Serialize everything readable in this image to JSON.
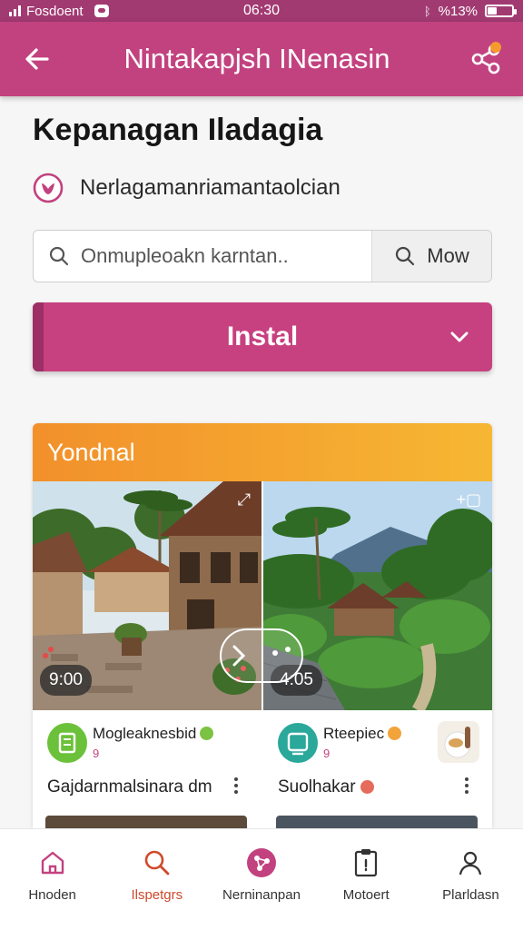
{
  "status_bar": {
    "carrier": "Fosdoent",
    "time": "06:30",
    "battery": "%13%"
  },
  "app_bar": {
    "title": "Nintakapjsh INenasin"
  },
  "page": {
    "heading": "Kepanagan Iladagia",
    "subtitle": "Nerlagamanriamantaolcian"
  },
  "search": {
    "placeholder": "Onmupleoakn karntan..",
    "button_label": "Mow"
  },
  "install_button": {
    "label": "Instal"
  },
  "section": {
    "title": "Yondnal",
    "items": [
      {
        "duration": "9:00",
        "username": "Mogleaknesbid",
        "badge": "9",
        "title": "Gajdarnmalsinara dm",
        "verified_color": "#7cc243",
        "icon_color": "#6cc13a"
      },
      {
        "duration": "4:05",
        "username": "Rteepiec",
        "badge": "9",
        "title": "Suolhakar",
        "verified_color": "#f2a33a",
        "icon_color": "#2aa89a"
      }
    ]
  },
  "bottom_nav": {
    "items": [
      {
        "label": "Hnoden",
        "icon": "home-icon"
      },
      {
        "label": "Ilspetgrs",
        "icon": "search-icon"
      },
      {
        "label": "Nerninanpan",
        "icon": "share-hub-icon"
      },
      {
        "label": "Motoert",
        "icon": "clipboard-icon"
      },
      {
        "label": "Plarldasn",
        "icon": "profile-icon"
      }
    ],
    "active_index": 1
  },
  "colors": {
    "primary": "#c2427f",
    "accent_orange": "#f2902b",
    "active_nav": "#d0492b"
  }
}
